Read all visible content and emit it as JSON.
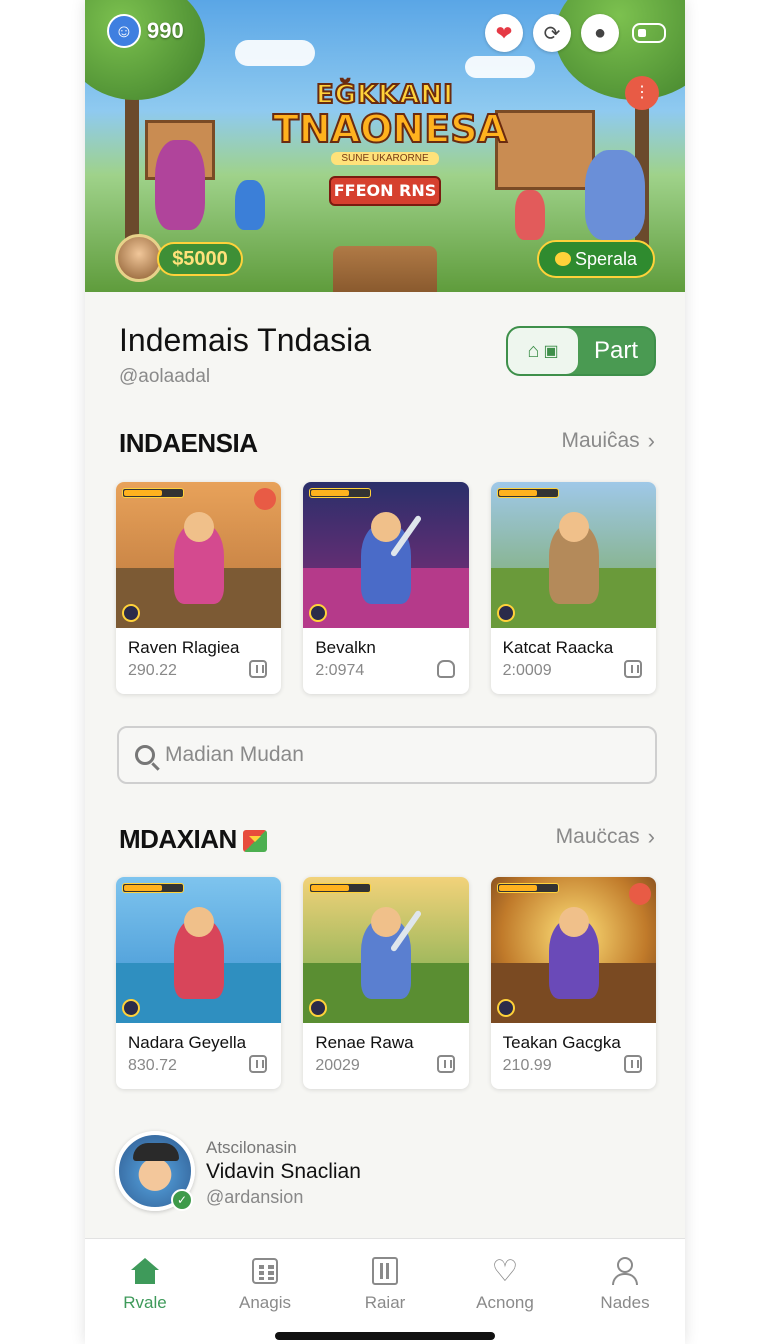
{
  "hero": {
    "coin_value": "990",
    "logo_line1": "EĞKKANI",
    "logo_line2": "TNAONESA",
    "logo_sub": "SUNE UKARORNE",
    "banner": "FFEON RNS",
    "price_pill": "$5000",
    "special_pill": "Sperala"
  },
  "profile": {
    "title": "Indemais Tndasia",
    "handle": "@aolaadal",
    "part_button": "Part"
  },
  "section1": {
    "title": "INDAENSIA",
    "more": "Mauiĉas",
    "cards": [
      {
        "name": "Raven Rlagiea",
        "meta": "290.22"
      },
      {
        "name": "Bevalkn",
        "meta": "2:0974"
      },
      {
        "name": "Katcat Raacka",
        "meta": "2:0009"
      }
    ]
  },
  "search": {
    "placeholder": "Madian Mudan"
  },
  "section2": {
    "title": "MDAXIAN",
    "more": "Mauc̈cas",
    "cards": [
      {
        "name": "Nadara Geyella",
        "meta": "830.72"
      },
      {
        "name": "Renae Rawa",
        "meta": "20029"
      },
      {
        "name": "Teakan Gacgka",
        "meta": "210.99"
      }
    ]
  },
  "creator": {
    "label": "Atscilonasin",
    "name": "Vidavin Snaclian",
    "handle": "@ardansion"
  },
  "nav": [
    {
      "label": "Rvale",
      "icon": "home-icon"
    },
    {
      "label": "Anagis",
      "icon": "grid-icon"
    },
    {
      "label": "Raiar",
      "icon": "document-icon"
    },
    {
      "label": "Acnong",
      "icon": "heart-icon"
    },
    {
      "label": "Nades",
      "icon": "user-icon"
    }
  ],
  "colors": {
    "accent": "#3e9a5a",
    "alert": "#e85b45"
  }
}
